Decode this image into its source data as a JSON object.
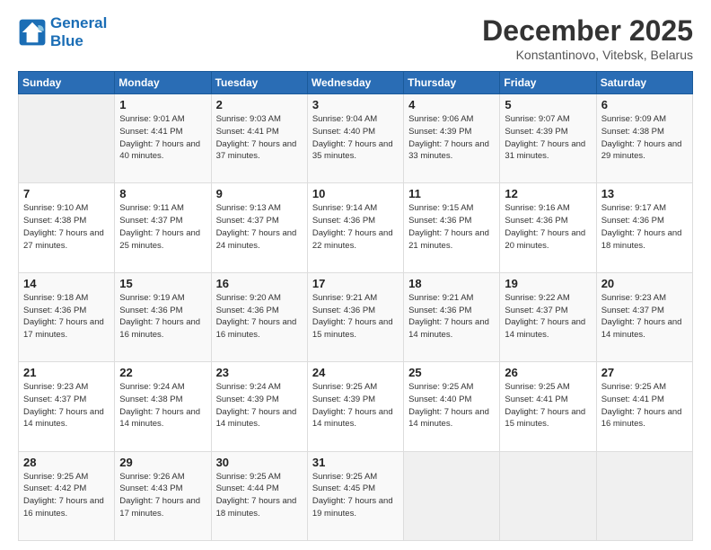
{
  "header": {
    "logo_line1": "General",
    "logo_line2": "Blue",
    "title": "December 2025",
    "location": "Konstantinovo, Vitebsk, Belarus"
  },
  "columns": [
    "Sunday",
    "Monday",
    "Tuesday",
    "Wednesday",
    "Thursday",
    "Friday",
    "Saturday"
  ],
  "weeks": [
    [
      {
        "num": "",
        "sunrise": "",
        "sunset": "",
        "daylight": ""
      },
      {
        "num": "1",
        "sunrise": "Sunrise: 9:01 AM",
        "sunset": "Sunset: 4:41 PM",
        "daylight": "Daylight: 7 hours and 40 minutes."
      },
      {
        "num": "2",
        "sunrise": "Sunrise: 9:03 AM",
        "sunset": "Sunset: 4:41 PM",
        "daylight": "Daylight: 7 hours and 37 minutes."
      },
      {
        "num": "3",
        "sunrise": "Sunrise: 9:04 AM",
        "sunset": "Sunset: 4:40 PM",
        "daylight": "Daylight: 7 hours and 35 minutes."
      },
      {
        "num": "4",
        "sunrise": "Sunrise: 9:06 AM",
        "sunset": "Sunset: 4:39 PM",
        "daylight": "Daylight: 7 hours and 33 minutes."
      },
      {
        "num": "5",
        "sunrise": "Sunrise: 9:07 AM",
        "sunset": "Sunset: 4:39 PM",
        "daylight": "Daylight: 7 hours and 31 minutes."
      },
      {
        "num": "6",
        "sunrise": "Sunrise: 9:09 AM",
        "sunset": "Sunset: 4:38 PM",
        "daylight": "Daylight: 7 hours and 29 minutes."
      }
    ],
    [
      {
        "num": "7",
        "sunrise": "Sunrise: 9:10 AM",
        "sunset": "Sunset: 4:38 PM",
        "daylight": "Daylight: 7 hours and 27 minutes."
      },
      {
        "num": "8",
        "sunrise": "Sunrise: 9:11 AM",
        "sunset": "Sunset: 4:37 PM",
        "daylight": "Daylight: 7 hours and 25 minutes."
      },
      {
        "num": "9",
        "sunrise": "Sunrise: 9:13 AM",
        "sunset": "Sunset: 4:37 PM",
        "daylight": "Daylight: 7 hours and 24 minutes."
      },
      {
        "num": "10",
        "sunrise": "Sunrise: 9:14 AM",
        "sunset": "Sunset: 4:36 PM",
        "daylight": "Daylight: 7 hours and 22 minutes."
      },
      {
        "num": "11",
        "sunrise": "Sunrise: 9:15 AM",
        "sunset": "Sunset: 4:36 PM",
        "daylight": "Daylight: 7 hours and 21 minutes."
      },
      {
        "num": "12",
        "sunrise": "Sunrise: 9:16 AM",
        "sunset": "Sunset: 4:36 PM",
        "daylight": "Daylight: 7 hours and 20 minutes."
      },
      {
        "num": "13",
        "sunrise": "Sunrise: 9:17 AM",
        "sunset": "Sunset: 4:36 PM",
        "daylight": "Daylight: 7 hours and 18 minutes."
      }
    ],
    [
      {
        "num": "14",
        "sunrise": "Sunrise: 9:18 AM",
        "sunset": "Sunset: 4:36 PM",
        "daylight": "Daylight: 7 hours and 17 minutes."
      },
      {
        "num": "15",
        "sunrise": "Sunrise: 9:19 AM",
        "sunset": "Sunset: 4:36 PM",
        "daylight": "Daylight: 7 hours and 16 minutes."
      },
      {
        "num": "16",
        "sunrise": "Sunrise: 9:20 AM",
        "sunset": "Sunset: 4:36 PM",
        "daylight": "Daylight: 7 hours and 16 minutes."
      },
      {
        "num": "17",
        "sunrise": "Sunrise: 9:21 AM",
        "sunset": "Sunset: 4:36 PM",
        "daylight": "Daylight: 7 hours and 15 minutes."
      },
      {
        "num": "18",
        "sunrise": "Sunrise: 9:21 AM",
        "sunset": "Sunset: 4:36 PM",
        "daylight": "Daylight: 7 hours and 14 minutes."
      },
      {
        "num": "19",
        "sunrise": "Sunrise: 9:22 AM",
        "sunset": "Sunset: 4:37 PM",
        "daylight": "Daylight: 7 hours and 14 minutes."
      },
      {
        "num": "20",
        "sunrise": "Sunrise: 9:23 AM",
        "sunset": "Sunset: 4:37 PM",
        "daylight": "Daylight: 7 hours and 14 minutes."
      }
    ],
    [
      {
        "num": "21",
        "sunrise": "Sunrise: 9:23 AM",
        "sunset": "Sunset: 4:37 PM",
        "daylight": "Daylight: 7 hours and 14 minutes."
      },
      {
        "num": "22",
        "sunrise": "Sunrise: 9:24 AM",
        "sunset": "Sunset: 4:38 PM",
        "daylight": "Daylight: 7 hours and 14 minutes."
      },
      {
        "num": "23",
        "sunrise": "Sunrise: 9:24 AM",
        "sunset": "Sunset: 4:39 PM",
        "daylight": "Daylight: 7 hours and 14 minutes."
      },
      {
        "num": "24",
        "sunrise": "Sunrise: 9:25 AM",
        "sunset": "Sunset: 4:39 PM",
        "daylight": "Daylight: 7 hours and 14 minutes."
      },
      {
        "num": "25",
        "sunrise": "Sunrise: 9:25 AM",
        "sunset": "Sunset: 4:40 PM",
        "daylight": "Daylight: 7 hours and 14 minutes."
      },
      {
        "num": "26",
        "sunrise": "Sunrise: 9:25 AM",
        "sunset": "Sunset: 4:41 PM",
        "daylight": "Daylight: 7 hours and 15 minutes."
      },
      {
        "num": "27",
        "sunrise": "Sunrise: 9:25 AM",
        "sunset": "Sunset: 4:41 PM",
        "daylight": "Daylight: 7 hours and 16 minutes."
      }
    ],
    [
      {
        "num": "28",
        "sunrise": "Sunrise: 9:25 AM",
        "sunset": "Sunset: 4:42 PM",
        "daylight": "Daylight: 7 hours and 16 minutes."
      },
      {
        "num": "29",
        "sunrise": "Sunrise: 9:26 AM",
        "sunset": "Sunset: 4:43 PM",
        "daylight": "Daylight: 7 hours and 17 minutes."
      },
      {
        "num": "30",
        "sunrise": "Sunrise: 9:25 AM",
        "sunset": "Sunset: 4:44 PM",
        "daylight": "Daylight: 7 hours and 18 minutes."
      },
      {
        "num": "31",
        "sunrise": "Sunrise: 9:25 AM",
        "sunset": "Sunset: 4:45 PM",
        "daylight": "Daylight: 7 hours and 19 minutes."
      },
      {
        "num": "",
        "sunrise": "",
        "sunset": "",
        "daylight": ""
      },
      {
        "num": "",
        "sunrise": "",
        "sunset": "",
        "daylight": ""
      },
      {
        "num": "",
        "sunrise": "",
        "sunset": "",
        "daylight": ""
      }
    ]
  ]
}
